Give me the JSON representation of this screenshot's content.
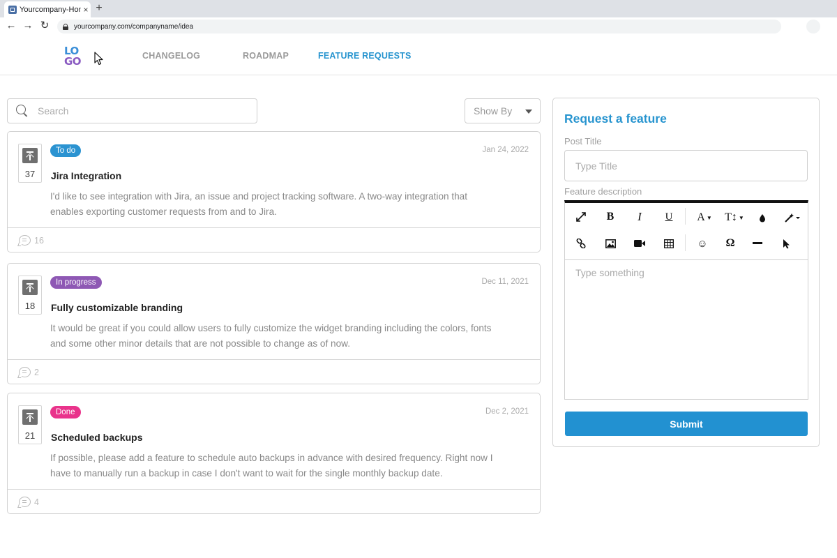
{
  "browser": {
    "tab_title": "Yourcompany-Home",
    "tab_close": "×",
    "new_tab": "+",
    "url": "yourcompany.com/companyname/idea"
  },
  "header": {
    "logo_line1": "LO",
    "logo_line2": "GO",
    "nav": [
      {
        "label": "CHANGELOG",
        "active": false
      },
      {
        "label": "ROADMAP",
        "active": false
      },
      {
        "label": "FEATURE REQUESTS",
        "active": true
      }
    ],
    "accent_color": "#2794cf"
  },
  "search": {
    "placeholder": "Search"
  },
  "filter": {
    "label": "Show By"
  },
  "requests": [
    {
      "votes": "37",
      "status": "To do",
      "status_color": "#2b93d1",
      "date": "Jan 24, 2022",
      "title": "Jira Integration",
      "description": "I'd like to see integration with Jira, an issue and project tracking software. A two-way integration that enables exporting customer requests from and to Jira.",
      "comments": "16"
    },
    {
      "votes": "18",
      "status": "In progress",
      "status_color": "#8e58b4",
      "date": "Dec 11, 2021",
      "title": "Fully customizable branding",
      "description": "It would be great if you could allow users to fully customize the widget branding including the colors, fonts and some other minor details that are not possible to change as of now.",
      "comments": "2"
    },
    {
      "votes": "21",
      "status": "Done",
      "status_color": "#e9338b",
      "date": "Dec 2, 2021",
      "title": "Scheduled backups",
      "description": "If possible, please add a feature to schedule auto backups in advance with desired frequency. Right now I have to manually run a backup in case I don't want to wait for the single monthly backup date.",
      "comments": "4"
    }
  ],
  "request_form": {
    "title": "Request a feature",
    "post_title_label": "Post Title",
    "post_title_placeholder": "Type Title",
    "description_label": "Feature description",
    "editor_placeholder": "Type something",
    "submit_label": "Submit",
    "toolbar_icons": [
      "fullscreen-icon",
      "bold-icon",
      "italic-icon",
      "underline-icon",
      "font-color-icon",
      "font-size-icon",
      "ink-drop-icon",
      "magic-wand-icon",
      "link-icon",
      "image-icon",
      "video-icon",
      "table-icon",
      "emoji-icon",
      "omega-icon",
      "horizontal-rule-icon",
      "cursor-icon"
    ]
  }
}
